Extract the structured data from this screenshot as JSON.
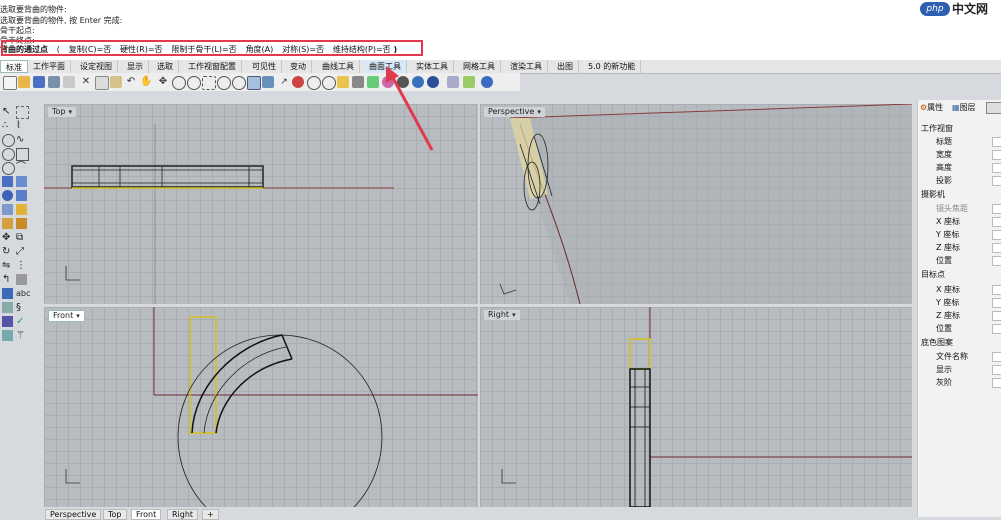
{
  "command_history": [
    "选取要背曲的物件:",
    "选取要背曲的物件, 按 Enter 完成:",
    "骨干起点:",
    "骨干终点:"
  ],
  "command_prompt": {
    "label": "背曲的通过点",
    "options": [
      "复制(C)=否",
      "硬性(R)=否",
      "限制于骨干(L)=否",
      "角度(A)",
      "对称(S)=否",
      "维持结构(P)=否",
      ")"
    ],
    "open_paren": "("
  },
  "toolbar_tabs": [
    {
      "label": "标准",
      "active": true
    },
    {
      "label": "工作平面"
    },
    {
      "label": "设定视图"
    },
    {
      "label": "显示"
    },
    {
      "label": "选取"
    },
    {
      "label": "工作视窗配置"
    },
    {
      "label": "可见性"
    },
    {
      "label": "变动"
    },
    {
      "label": "曲线工具"
    },
    {
      "label": "曲面工具",
      "highlight": true
    },
    {
      "label": "实体工具"
    },
    {
      "label": "网格工具"
    },
    {
      "label": "渲染工具"
    },
    {
      "label": "出图"
    },
    {
      "label": "5.0 的新功能"
    }
  ],
  "viewports": {
    "top": {
      "title": "Top"
    },
    "perspective": {
      "title": "Perspective"
    },
    "front": {
      "title": "Front"
    },
    "right": {
      "title": "Right"
    }
  },
  "properties_panel": {
    "tab_properties": "属性",
    "tab_layers": "图层",
    "section_viewport": "工作视窗",
    "title_label": "标题",
    "width_label": "宽度",
    "height_label": "高度",
    "projection_label": "投影",
    "section_camera": "摄影机",
    "lens_label": "镜头焦距",
    "x_label": "X 座标",
    "y_label": "Y 座标",
    "z_label": "Z 座标",
    "position_label": "位置",
    "section_target": "目标点",
    "tx_label": "X 座标",
    "ty_label": "Y 座标",
    "tz_label": "Z 座标",
    "tposition_label": "位置",
    "section_wallpaper": "底色图案",
    "filename_label": "文件名称",
    "show_label": "显示",
    "gray_label": "灰阶"
  },
  "bottom_tabs": [
    "Perspective",
    "Top",
    "Front",
    "Right",
    "+"
  ],
  "watermark": {
    "logo": "php",
    "text": "中文网"
  },
  "colors": {
    "highlight_box": "#e03a4f",
    "arrow": "#e03a4f",
    "grid_bg": "#b8bcc1",
    "selected_curve": "#d4c21a"
  }
}
